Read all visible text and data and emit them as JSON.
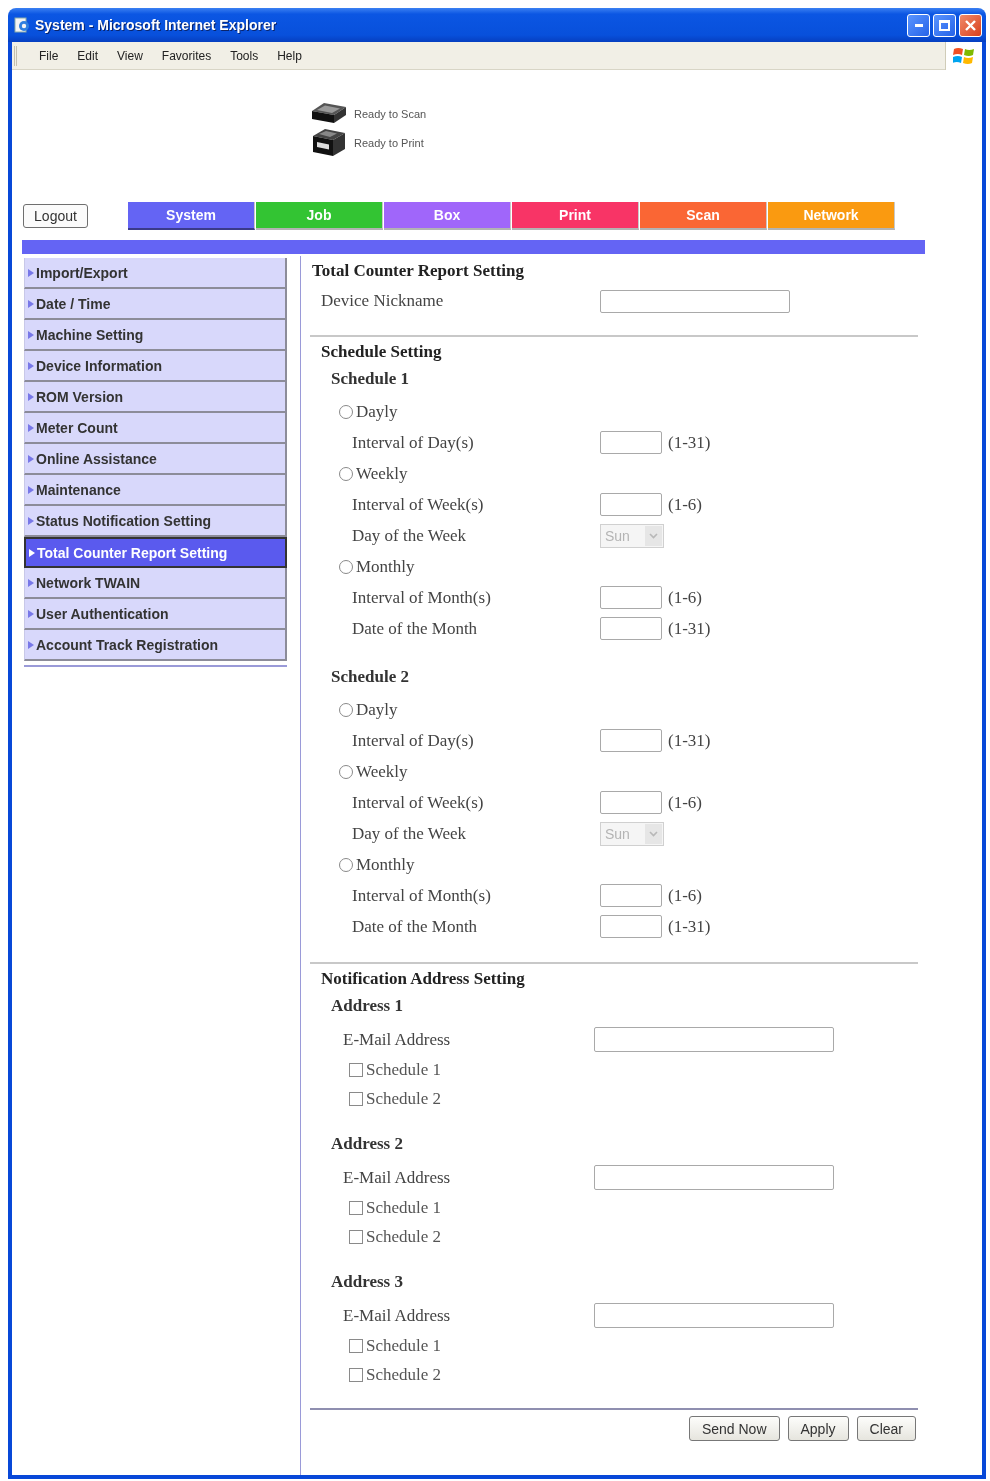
{
  "window": {
    "title": "System - Microsoft Internet Explorer"
  },
  "menu": [
    "File",
    "Edit",
    "View",
    "Favorites",
    "Tools",
    "Help"
  ],
  "device_status": [
    {
      "kind": "scanner",
      "label": "Ready to Scan"
    },
    {
      "kind": "printer",
      "label": "Ready to Print"
    }
  ],
  "logout_button": "Logout",
  "tabs": [
    {
      "label": "System",
      "color": "#6464f4",
      "selected": true
    },
    {
      "label": "Job",
      "color": "#33c433",
      "selected": false
    },
    {
      "label": "Box",
      "color": "#a066fa",
      "selected": false
    },
    {
      "label": "Print",
      "color": "#f83466",
      "selected": false
    },
    {
      "label": "Scan",
      "color": "#fa6634",
      "selected": false
    },
    {
      "label": "Network",
      "color": "#fa9a10",
      "selected": false
    }
  ],
  "sidebar": {
    "items": [
      {
        "label": "Import/Export",
        "selected": false
      },
      {
        "label": "Date / Time",
        "selected": false
      },
      {
        "label": "Machine Setting",
        "selected": false
      },
      {
        "label": "Device Information",
        "selected": false
      },
      {
        "label": "ROM Version",
        "selected": false
      },
      {
        "label": "Meter Count",
        "selected": false
      },
      {
        "label": "Online Assistance",
        "selected": false
      },
      {
        "label": "Maintenance",
        "selected": false
      },
      {
        "label": "Status Notification Setting",
        "selected": false
      },
      {
        "label": "Total Counter Report Setting",
        "selected": true
      },
      {
        "label": "Network TWAIN",
        "selected": false
      },
      {
        "label": "User Authentication",
        "selected": false
      },
      {
        "label": "Account Track Registration",
        "selected": false
      }
    ]
  },
  "form": {
    "title": "Total Counter Report Setting",
    "nickname": {
      "label": "Device Nickname"
    },
    "schedule_setting": {
      "title": "Schedule Setting",
      "schedules": [
        {
          "title": "Schedule 1",
          "rows": [
            {
              "kind": "radio",
              "label": "Dayly",
              "selected": false
            },
            {
              "kind": "number",
              "label": "Interval of Day(s)",
              "range": "(1-31)"
            },
            {
              "kind": "radio",
              "label": "Weekly",
              "selected": false
            },
            {
              "kind": "number",
              "label": "Interval of Week(s)",
              "range": "(1-6)"
            },
            {
              "kind": "select",
              "label": "Day of the Week",
              "value": "Sun",
              "disabled": true
            },
            {
              "kind": "radio",
              "label": "Monthly",
              "selected": false
            },
            {
              "kind": "number",
              "label": "Interval of Month(s)",
              "range": "(1-6)"
            },
            {
              "kind": "number",
              "label": "Date of the Month",
              "range": "(1-31)"
            }
          ]
        },
        {
          "title": "Schedule 2",
          "rows": [
            {
              "kind": "radio",
              "label": "Dayly",
              "selected": false
            },
            {
              "kind": "number",
              "label": "Interval of Day(s)",
              "range": "(1-31)"
            },
            {
              "kind": "radio",
              "label": "Weekly",
              "selected": false
            },
            {
              "kind": "number",
              "label": "Interval of Week(s)",
              "range": "(1-6)"
            },
            {
              "kind": "select",
              "label": "Day of the Week",
              "value": "Sun",
              "disabled": true
            },
            {
              "kind": "radio",
              "label": "Monthly",
              "selected": false
            },
            {
              "kind": "number",
              "label": "Interval of Month(s)",
              "range": "(1-6)"
            },
            {
              "kind": "number",
              "label": "Date of the Month",
              "range": "(1-31)"
            }
          ]
        }
      ]
    },
    "notification": {
      "title": "Notification Address Setting",
      "addresses": [
        {
          "title": "Address 1",
          "email_label": "E-Mail Address",
          "schedules": [
            {
              "label": "Schedule 1",
              "checked": false
            },
            {
              "label": "Schedule 2",
              "checked": false
            }
          ]
        },
        {
          "title": "Address 2",
          "email_label": "E-Mail Address",
          "schedules": [
            {
              "label": "Schedule 1",
              "checked": false
            },
            {
              "label": "Schedule 2",
              "checked": false
            }
          ]
        },
        {
          "title": "Address 3",
          "email_label": "E-Mail Address",
          "schedules": [
            {
              "label": "Schedule 1",
              "checked": false
            },
            {
              "label": "Schedule 2",
              "checked": false
            }
          ]
        }
      ]
    }
  },
  "buttons": [
    "Send Now",
    "Apply",
    "Clear"
  ]
}
